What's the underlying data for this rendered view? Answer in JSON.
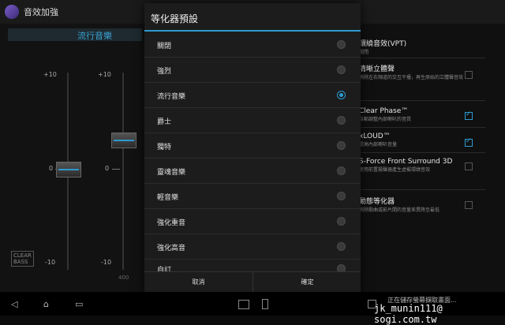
{
  "topbar": {
    "title": "音效加強"
  },
  "equalizer": {
    "preset_name": "流行音樂",
    "scale_top": "+10",
    "scale_zero": "0",
    "scale_bottom": "-10",
    "clear_bass_line1": "CLEAR",
    "clear_bass_line2": "BASS",
    "freq_label": "400"
  },
  "settings": {
    "items": [
      {
        "title": "環繞音效(VPT)",
        "sub": "關閉",
        "checked": false
      },
      {
        "title": "清晰立體聲",
        "sub": "消除左右頻道的交互干擾，再生原始的立體聲音效",
        "checked": false
      },
      {
        "title": "Clear Phase™",
        "sub": "自動調整內部喇叭的音質",
        "checked": true
      },
      {
        "title": "xLOUD™",
        "sub": "提高內部喇叭音量",
        "checked": true
      },
      {
        "title": "S-Force Front Surround 3D",
        "sub": "使用前置揚聲器產生虛擬環繞音效",
        "checked": false
      },
      {
        "title": "動態等化器",
        "sub": "消除歌曲或影片間的音量差異降至最低",
        "checked": false
      }
    ]
  },
  "dialog": {
    "title": "等化器預設",
    "options": [
      "關閉",
      "強烈",
      "流行音樂",
      "爵士",
      "獨特",
      "靈魂音樂",
      "輕音樂",
      "強化重音",
      "強化高音",
      "自訂"
    ],
    "selected_index": 2,
    "cancel_label": "取消",
    "ok_label": "確定"
  },
  "navbar": {
    "back_icon": "◁",
    "home_icon": "⌂",
    "recents_icon": "▭",
    "status_text": "正在儲存螢幕擷取畫面..."
  },
  "watermark": "jk_munin111@ sogi.com.tw",
  "colors": {
    "accent": "#2e9ad0"
  }
}
